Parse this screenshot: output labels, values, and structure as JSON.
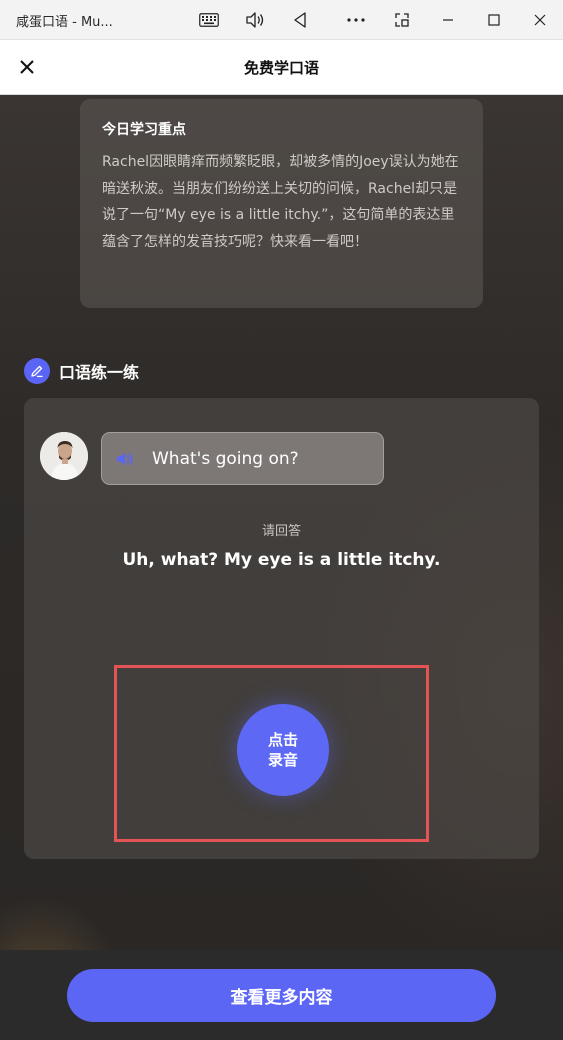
{
  "window": {
    "title": "咸蛋口语 - Mu..."
  },
  "header": {
    "title": "免费学口语"
  },
  "focus": {
    "title": "今日学习重点",
    "body": "Rachel因眼睛痒而频繁眨眼，却被多情的Joey误认为她在暗送秋波。当朋友们纷纷送上关切的问候，Rachel却只是说了一句“My eye is a little itchy.”，这句简单的表达里蕴含了怎样的发音技巧呢？快来看一看吧！"
  },
  "practice": {
    "section_title": "口语练一练",
    "question": "What's going on?",
    "prompt_label": "请回答",
    "answer": "Uh, what? My eye is a little itchy.",
    "record_line1": "点击",
    "record_line2": "录音"
  },
  "footer": {
    "more_label": "查看更多内容"
  },
  "colors": {
    "accent": "#5b66f5",
    "highlight_frame": "#e45454"
  },
  "icons": {
    "keyboard": "keyboard-icon",
    "volume": "volume-icon",
    "back": "back-triangle-icon",
    "more": "more-dots-icon",
    "screenshot": "screenshot-icon",
    "minimize": "minimize-icon",
    "maximize": "maximize-icon",
    "close": "close-icon",
    "edit": "pencil-icon",
    "speaker": "speaker-icon"
  }
}
